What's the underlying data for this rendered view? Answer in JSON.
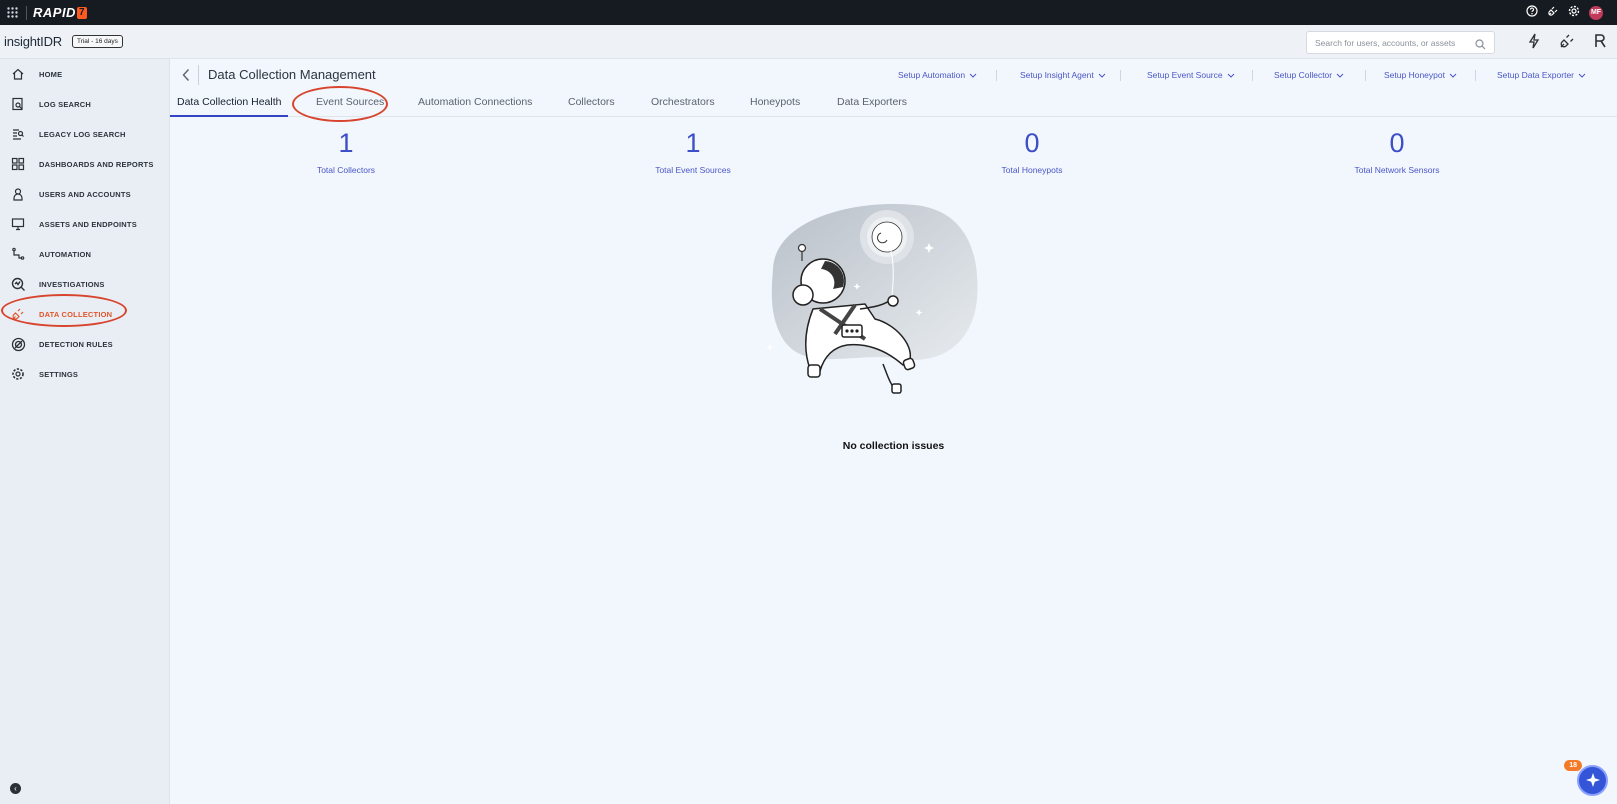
{
  "brand": {
    "name": "RAPID",
    "mark": "7"
  },
  "top_bar": {
    "avatar_initials": "MF"
  },
  "product": {
    "name": "insightIDR",
    "trial": "Trial - 16 days",
    "search_placeholder": "Search for users, accounts, or assets"
  },
  "sidebar": {
    "items": [
      {
        "label": "HOME",
        "icon": "home-icon"
      },
      {
        "label": "LOG SEARCH",
        "icon": "log-search-icon"
      },
      {
        "label": "LEGACY LOG SEARCH",
        "icon": "legacy-log-search-icon"
      },
      {
        "label": "DASHBOARDS AND REPORTS",
        "icon": "dashboards-icon"
      },
      {
        "label": "USERS AND ACCOUNTS",
        "icon": "user-icon"
      },
      {
        "label": "ASSETS AND ENDPOINTS",
        "icon": "monitor-icon"
      },
      {
        "label": "AUTOMATION",
        "icon": "automation-icon"
      },
      {
        "label": "INVESTIGATIONS",
        "icon": "investigations-icon"
      },
      {
        "label": "DATA COLLECTION",
        "icon": "plug-icon"
      },
      {
        "label": "DETECTION RULES",
        "icon": "detection-icon"
      },
      {
        "label": "SETTINGS",
        "icon": "gear-icon"
      }
    ],
    "active_index": 8
  },
  "page": {
    "title": "Data Collection Management",
    "setup_menus": [
      "Setup Automation",
      "Setup Insight Agent",
      "Setup Event Source",
      "Setup Collector",
      "Setup Honeypot",
      "Setup Data Exporter"
    ],
    "tabs": [
      "Data Collection Health",
      "Event Sources",
      "Automation Connections",
      "Collectors",
      "Orchestrators",
      "Honeypots",
      "Data Exporters"
    ],
    "active_tab": 0,
    "stats": [
      {
        "value": "1",
        "label": "Total Collectors"
      },
      {
        "value": "1",
        "label": "Total Event Sources"
      },
      {
        "value": "0",
        "label": "Total Honeypots"
      },
      {
        "value": "0",
        "label": "Total Network Sensors"
      }
    ],
    "empty_message": "No collection issues"
  },
  "helper": {
    "count": "18"
  },
  "colors": {
    "accent": "#3d4fc6",
    "active_nav": "#e2552a",
    "annotation": "#d8452e",
    "topbar": "#161b22"
  }
}
